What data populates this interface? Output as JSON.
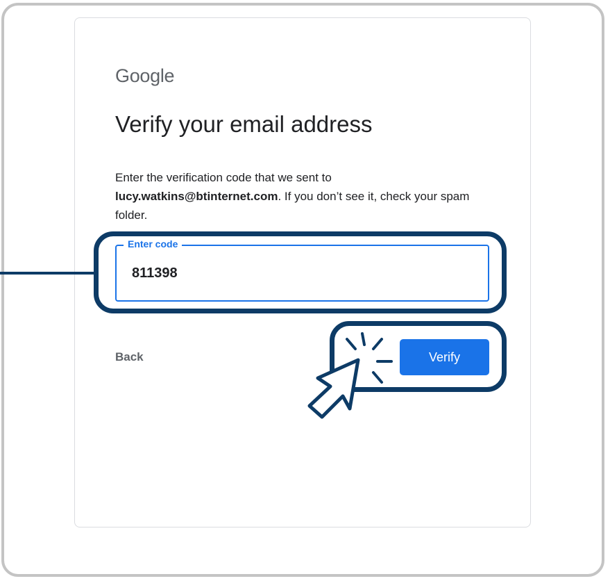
{
  "logo": {
    "text": "Google"
  },
  "page": {
    "title": "Verify your email address",
    "description_prefix": "Enter the verification code that we sent to ",
    "email": "lucy.watkins@btinternet.com",
    "description_suffix": ". If you don’t see it, check your spam folder."
  },
  "code_field": {
    "label": "Enter code",
    "value": "811398"
  },
  "actions": {
    "back_label": "Back",
    "verify_label": "Verify"
  },
  "colors": {
    "accent": "#1a73e8",
    "highlight": "#0d3b66"
  },
  "icons": {
    "cursor": "hand-pointer-click-icon"
  }
}
